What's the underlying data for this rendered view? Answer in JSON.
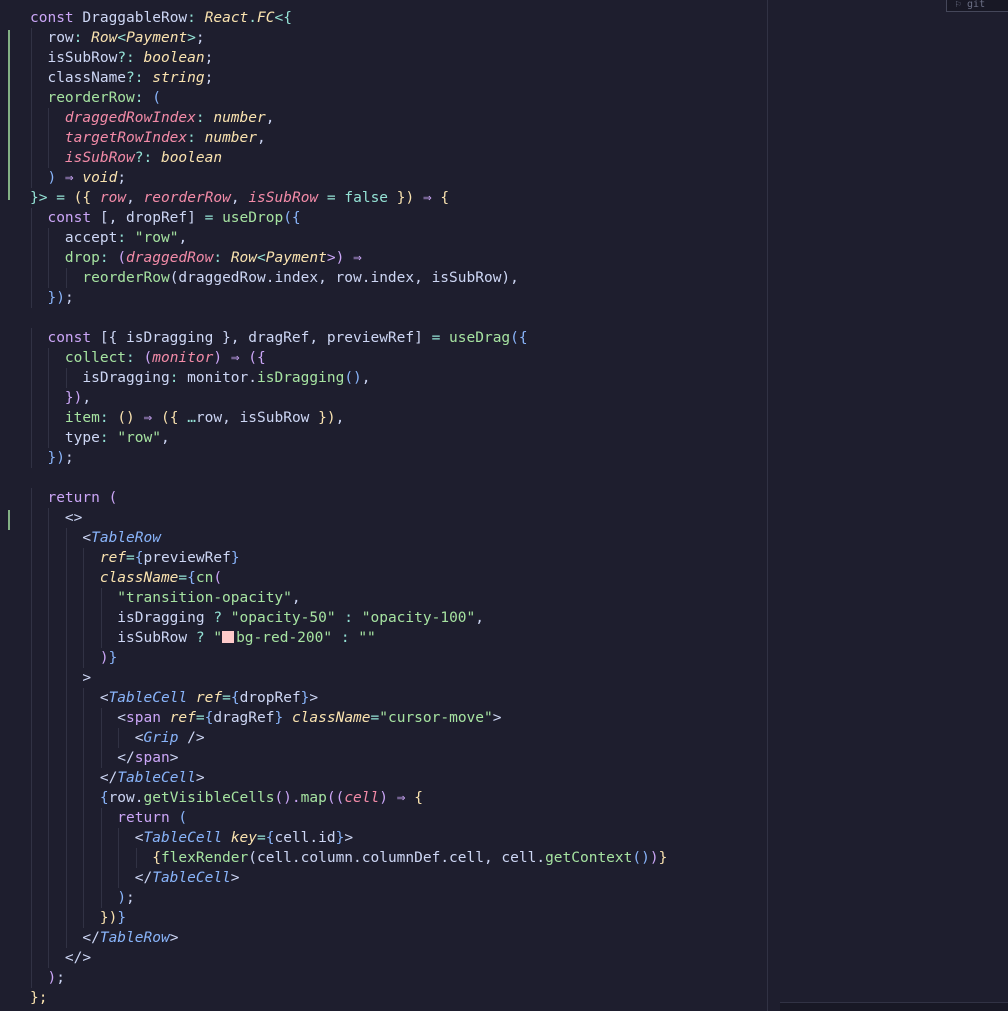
{
  "editor": {
    "top_widget_text": "⚐ git",
    "lines": [
      [
        {
          "t": "const ",
          "c": "kw"
        },
        {
          "t": "DraggableRow",
          "c": "prop"
        },
        {
          "t": ": ",
          "c": "op"
        },
        {
          "t": "React",
          "c": "ty"
        },
        {
          "t": ".",
          "c": "op"
        },
        {
          "t": "FC",
          "c": "ty"
        },
        {
          "t": "<{",
          "c": "op"
        }
      ],
      [
        {
          "t": "  row",
          "c": "prop"
        },
        {
          "t": ": ",
          "c": "op"
        },
        {
          "t": "Row",
          "c": "ty"
        },
        {
          "t": "<",
          "c": "op"
        },
        {
          "t": "Payment",
          "c": "ty"
        },
        {
          "t": ">",
          "c": "op"
        },
        {
          "t": ";",
          "c": "prop"
        }
      ],
      [
        {
          "t": "  isSubRow",
          "c": "prop"
        },
        {
          "t": "?: ",
          "c": "op"
        },
        {
          "t": "boolean",
          "c": "ty"
        },
        {
          "t": ";",
          "c": "prop"
        }
      ],
      [
        {
          "t": "  className",
          "c": "prop"
        },
        {
          "t": "?: ",
          "c": "op"
        },
        {
          "t": "string",
          "c": "ty"
        },
        {
          "t": ";",
          "c": "prop"
        }
      ],
      [
        {
          "t": "  reorderRow",
          "c": "str"
        },
        {
          "t": ": ",
          "c": "op"
        },
        {
          "t": "(",
          "c": "br3"
        }
      ],
      [
        {
          "t": "    draggedRowIndex",
          "c": "it"
        },
        {
          "t": ": ",
          "c": "op"
        },
        {
          "t": "number",
          "c": "ty"
        },
        {
          "t": ",",
          "c": "prop"
        }
      ],
      [
        {
          "t": "    targetRowIndex",
          "c": "it"
        },
        {
          "t": ": ",
          "c": "op"
        },
        {
          "t": "number",
          "c": "ty"
        },
        {
          "t": ",",
          "c": "prop"
        }
      ],
      [
        {
          "t": "    isSubRow",
          "c": "it"
        },
        {
          "t": "?: ",
          "c": "op"
        },
        {
          "t": "boolean",
          "c": "ty"
        }
      ],
      [
        {
          "t": "  ) ",
          "c": "br3"
        },
        {
          "t": "⇒ ",
          "c": "kw"
        },
        {
          "t": "void",
          "c": "ty"
        },
        {
          "t": ";",
          "c": "prop"
        }
      ],
      [
        {
          "t": "}> ",
          "c": "op"
        },
        {
          "t": "= ",
          "c": "op"
        },
        {
          "t": "({ ",
          "c": "br1"
        },
        {
          "t": "row",
          "c": "it"
        },
        {
          "t": ", ",
          "c": "prop"
        },
        {
          "t": "reorderRow",
          "c": "it"
        },
        {
          "t": ", ",
          "c": "prop"
        },
        {
          "t": "isSubRow",
          "c": "it"
        },
        {
          "t": " = ",
          "c": "op"
        },
        {
          "t": "false",
          "c": "op"
        },
        {
          "t": " }) ",
          "c": "br1"
        },
        {
          "t": "⇒ ",
          "c": "kw"
        },
        {
          "t": "{",
          "c": "br1"
        }
      ],
      [
        {
          "t": "  const ",
          "c": "kw"
        },
        {
          "t": "[, dropRef] ",
          "c": "prop"
        },
        {
          "t": "= ",
          "c": "op"
        },
        {
          "t": "useDrop",
          "c": "str"
        },
        {
          "t": "({",
          "c": "br3"
        }
      ],
      [
        {
          "t": "    accept",
          "c": "prop"
        },
        {
          "t": ": ",
          "c": "op"
        },
        {
          "t": "\"row\"",
          "c": "str"
        },
        {
          "t": ",",
          "c": "prop"
        }
      ],
      [
        {
          "t": "    drop",
          "c": "str"
        },
        {
          "t": ": ",
          "c": "op"
        },
        {
          "t": "(",
          "c": "br2"
        },
        {
          "t": "draggedRow",
          "c": "it"
        },
        {
          "t": ": ",
          "c": "op"
        },
        {
          "t": "Row",
          "c": "ty"
        },
        {
          "t": "<",
          "c": "op"
        },
        {
          "t": "Payment",
          "c": "ty"
        },
        {
          "t": ">) ",
          "c": "br2"
        },
        {
          "t": "⇒",
          "c": "kw"
        }
      ],
      [
        {
          "t": "      reorderRow",
          "c": "str"
        },
        {
          "t": "(draggedRow.index, row.index, isSubRow)",
          "c": "prop"
        },
        {
          "t": ",",
          "c": "prop"
        }
      ],
      [
        {
          "t": "  ",
          "c": "prop"
        },
        {
          "t": "})",
          "c": "br3"
        },
        {
          "t": ";",
          "c": "prop"
        }
      ],
      [],
      [
        {
          "t": "  const ",
          "c": "kw"
        },
        {
          "t": "[{ isDragging }, dragRef, previewRef] ",
          "c": "prop"
        },
        {
          "t": "= ",
          "c": "op"
        },
        {
          "t": "useDrag",
          "c": "str"
        },
        {
          "t": "({",
          "c": "br3"
        }
      ],
      [
        {
          "t": "    collect",
          "c": "str"
        },
        {
          "t": ": ",
          "c": "op"
        },
        {
          "t": "(",
          "c": "br2"
        },
        {
          "t": "monitor",
          "c": "it"
        },
        {
          "t": ") ",
          "c": "br2"
        },
        {
          "t": "⇒ ",
          "c": "kw"
        },
        {
          "t": "({",
          "c": "br2"
        }
      ],
      [
        {
          "t": "      isDragging",
          "c": "prop"
        },
        {
          "t": ": ",
          "c": "op"
        },
        {
          "t": "monitor.",
          "c": "prop"
        },
        {
          "t": "isDragging",
          "c": "str"
        },
        {
          "t": "()",
          "c": "br3"
        },
        {
          "t": ",",
          "c": "prop"
        }
      ],
      [
        {
          "t": "    ",
          "c": "prop"
        },
        {
          "t": "})",
          "c": "br2"
        },
        {
          "t": ",",
          "c": "prop"
        }
      ],
      [
        {
          "t": "    item",
          "c": "str"
        },
        {
          "t": ": ",
          "c": "op"
        },
        {
          "t": "() ",
          "c": "br1"
        },
        {
          "t": "⇒ ",
          "c": "kw"
        },
        {
          "t": "({ ",
          "c": "br1"
        },
        {
          "t": "…",
          "c": "op"
        },
        {
          "t": "row, isSubRow ",
          "c": "prop"
        },
        {
          "t": "})",
          "c": "br1"
        },
        {
          "t": ",",
          "c": "prop"
        }
      ],
      [
        {
          "t": "    type",
          "c": "prop"
        },
        {
          "t": ": ",
          "c": "op"
        },
        {
          "t": "\"row\"",
          "c": "str"
        },
        {
          "t": ",",
          "c": "prop"
        }
      ],
      [
        {
          "t": "  ",
          "c": "prop"
        },
        {
          "t": "})",
          "c": "br3"
        },
        {
          "t": ";",
          "c": "prop"
        }
      ],
      [],
      [
        {
          "t": "  return ",
          "c": "kw"
        },
        {
          "t": "(",
          "c": "br2"
        }
      ],
      [
        {
          "t": "    <>",
          "c": "prop"
        }
      ],
      [
        {
          "t": "      <",
          "c": "prop"
        },
        {
          "t": "TableRow",
          "c": "tag"
        }
      ],
      [
        {
          "t": "        ref",
          "c": "attr"
        },
        {
          "t": "=",
          "c": "op"
        },
        {
          "t": "{",
          "c": "br3"
        },
        {
          "t": "previewRef",
          "c": "prop"
        },
        {
          "t": "}",
          "c": "br3"
        }
      ],
      [
        {
          "t": "        className",
          "c": "attr"
        },
        {
          "t": "=",
          "c": "op"
        },
        {
          "t": "{",
          "c": "br3"
        },
        {
          "t": "cn",
          "c": "str"
        },
        {
          "t": "(",
          "c": "br2"
        }
      ],
      [
        {
          "t": "          \"transition-opacity\"",
          "c": "str"
        },
        {
          "t": ",",
          "c": "prop"
        }
      ],
      [
        {
          "t": "          isDragging ",
          "c": "prop"
        },
        {
          "t": "? ",
          "c": "op"
        },
        {
          "t": "\"opacity-50\"",
          "c": "str"
        },
        {
          "t": " : ",
          "c": "op"
        },
        {
          "t": "\"opacity-100\"",
          "c": "str"
        },
        {
          "t": ",",
          "c": "prop"
        }
      ],
      [
        {
          "t": "          isSubRow ",
          "c": "prop"
        },
        {
          "t": "? ",
          "c": "op"
        },
        {
          "t": "\"",
          "c": "str"
        },
        {
          "t": "SWATCH",
          "c": "swatch"
        },
        {
          "t": "bg-red-200\"",
          "c": "str"
        },
        {
          "t": " : ",
          "c": "op"
        },
        {
          "t": "\"\"",
          "c": "str"
        }
      ],
      [
        {
          "t": "        ",
          "c": "prop"
        },
        {
          "t": ")",
          "c": "br2"
        },
        {
          "t": "}",
          "c": "br3"
        }
      ],
      [
        {
          "t": "      >",
          "c": "prop"
        }
      ],
      [
        {
          "t": "        <",
          "c": "prop"
        },
        {
          "t": "TableCell ",
          "c": "tag"
        },
        {
          "t": "ref",
          "c": "attr"
        },
        {
          "t": "=",
          "c": "op"
        },
        {
          "t": "{",
          "c": "br3"
        },
        {
          "t": "dropRef",
          "c": "prop"
        },
        {
          "t": "}",
          "c": "br3"
        },
        {
          "t": ">",
          "c": "prop"
        }
      ],
      [
        {
          "t": "          <",
          "c": "prop"
        },
        {
          "t": "span ",
          "c": "kw"
        },
        {
          "t": "ref",
          "c": "attr"
        },
        {
          "t": "=",
          "c": "op"
        },
        {
          "t": "{",
          "c": "br3"
        },
        {
          "t": "dragRef",
          "c": "prop"
        },
        {
          "t": "} ",
          "c": "br3"
        },
        {
          "t": "className",
          "c": "attr"
        },
        {
          "t": "=",
          "c": "op"
        },
        {
          "t": "\"cursor-move\"",
          "c": "str"
        },
        {
          "t": ">",
          "c": "prop"
        }
      ],
      [
        {
          "t": "            <",
          "c": "prop"
        },
        {
          "t": "Grip ",
          "c": "tag"
        },
        {
          "t": "/>",
          "c": "prop"
        }
      ],
      [
        {
          "t": "          </",
          "c": "prop"
        },
        {
          "t": "span",
          "c": "kw"
        },
        {
          "t": ">",
          "c": "prop"
        }
      ],
      [
        {
          "t": "        </",
          "c": "prop"
        },
        {
          "t": "TableCell",
          "c": "tag"
        },
        {
          "t": ">",
          "c": "prop"
        }
      ],
      [
        {
          "t": "        {",
          "c": "br3"
        },
        {
          "t": "row.",
          "c": "prop"
        },
        {
          "t": "getVisibleCells",
          "c": "str"
        },
        {
          "t": "().",
          "c": "br2"
        },
        {
          "t": "map",
          "c": "str"
        },
        {
          "t": "((",
          "c": "br2"
        },
        {
          "t": "cell",
          "c": "it"
        },
        {
          "t": ") ",
          "c": "br2"
        },
        {
          "t": "⇒ ",
          "c": "kw"
        },
        {
          "t": "{",
          "c": "br1"
        }
      ],
      [
        {
          "t": "          return ",
          "c": "kw"
        },
        {
          "t": "(",
          "c": "br3"
        }
      ],
      [
        {
          "t": "            <",
          "c": "prop"
        },
        {
          "t": "TableCell ",
          "c": "tag"
        },
        {
          "t": "key",
          "c": "attr"
        },
        {
          "t": "=",
          "c": "op"
        },
        {
          "t": "{",
          "c": "br3"
        },
        {
          "t": "cell.id",
          "c": "prop"
        },
        {
          "t": "}",
          "c": "br3"
        },
        {
          "t": ">",
          "c": "prop"
        }
      ],
      [
        {
          "t": "              {",
          "c": "br1"
        },
        {
          "t": "flexRender",
          "c": "str"
        },
        {
          "t": "(cell.column.columnDef.cell, cell.",
          "c": "prop"
        },
        {
          "t": "getContext",
          "c": "str"
        },
        {
          "t": "()",
          "c": "br3"
        },
        {
          "t": ")",
          "c": "br2"
        },
        {
          "t": "}",
          "c": "br1"
        }
      ],
      [
        {
          "t": "            </",
          "c": "prop"
        },
        {
          "t": "TableCell",
          "c": "tag"
        },
        {
          "t": ">",
          "c": "prop"
        }
      ],
      [
        {
          "t": "          ",
          "c": "prop"
        },
        {
          "t": ")",
          "c": "br3"
        },
        {
          "t": ";",
          "c": "prop"
        }
      ],
      [
        {
          "t": "        ",
          "c": "prop"
        },
        {
          "t": "})",
          "c": "br1"
        },
        {
          "t": "}",
          "c": "br3"
        }
      ],
      [
        {
          "t": "      </",
          "c": "prop"
        },
        {
          "t": "TableRow",
          "c": "tag"
        },
        {
          "t": ">",
          "c": "prop"
        }
      ],
      [
        {
          "t": "    </>",
          "c": "prop"
        }
      ],
      [
        {
          "t": "  ",
          "c": "prop"
        },
        {
          "t": ")",
          "c": "br2"
        },
        {
          "t": ";",
          "c": "prop"
        }
      ],
      [
        {
          "t": "};",
          "c": "br1"
        }
      ]
    ]
  }
}
